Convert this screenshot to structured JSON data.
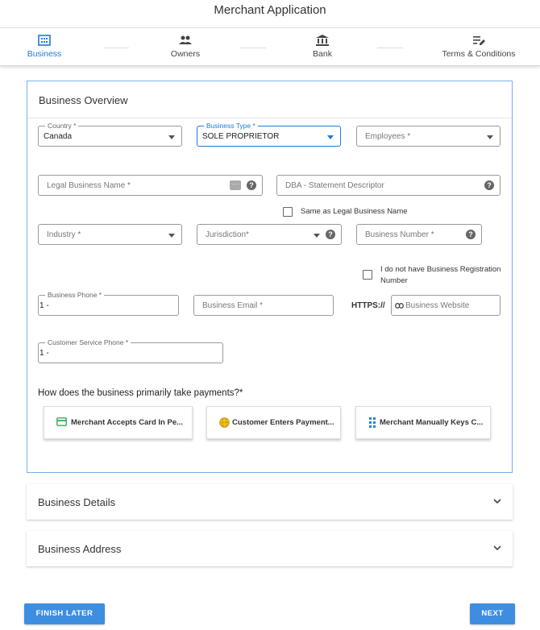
{
  "app": {
    "title": "Merchant Application"
  },
  "stepper": {
    "steps": [
      {
        "label": "Business",
        "icon": "building-icon",
        "active": true
      },
      {
        "label": "Owners",
        "icon": "people-icon",
        "active": false
      },
      {
        "label": "Bank",
        "icon": "bank-icon",
        "active": false
      },
      {
        "label": "Terms & Conditions",
        "icon": "edit-list-icon",
        "active": false
      }
    ]
  },
  "overview": {
    "title": "Business Overview",
    "country": {
      "label": "Country *",
      "value": "Canada"
    },
    "business_type": {
      "label": "Business Type *",
      "value": "SOLE PROPRIETOR"
    },
    "employees": {
      "placeholder": "Employees *"
    },
    "legal_name": {
      "placeholder": "Legal Business Name *"
    },
    "dba": {
      "placeholder": "DBA - Statement Descriptor"
    },
    "same_as_legal": {
      "label": "Same as Legal Business Name",
      "checked": false
    },
    "industry": {
      "placeholder": "Industry *"
    },
    "jurisdiction": {
      "placeholder": "Jurisdiction*"
    },
    "business_number": {
      "placeholder": "Business Number *"
    },
    "no_registration": {
      "label_line1": "I do not have Business Registration",
      "label_line2": "Number",
      "checked": false
    },
    "business_phone": {
      "label": "Business Phone *",
      "value": "1 -"
    },
    "business_email": {
      "placeholder": "Business Email *"
    },
    "https_prefix": "HTTPS://",
    "business_website": {
      "placeholder": "Business Website"
    },
    "customer_phone": {
      "label": "Customer Service Phone *",
      "value": "1 -"
    },
    "payment_question": "How does the business primarily take payments?*",
    "payment_options": [
      {
        "label": "Merchant Accepts Card In Pe...",
        "icon": "credit-card-icon"
      },
      {
        "label": "Customer Enters Payment...",
        "icon": "globe-icon"
      },
      {
        "label": "Merchant Manually Keys C...",
        "icon": "keypad-icon"
      }
    ]
  },
  "sections": [
    {
      "title": "Business Details"
    },
    {
      "title": "Business Address"
    }
  ],
  "footer": {
    "finish_later": "FINISH LATER",
    "next": "NEXT"
  },
  "colors": {
    "accent": "#1e7bd6",
    "button": "#3e8ee0",
    "card_border": "#7aaee8"
  }
}
